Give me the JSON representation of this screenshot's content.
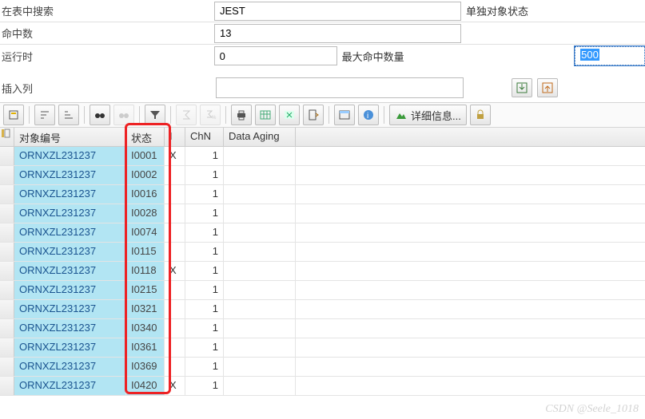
{
  "form": {
    "search_label": "在表中搜索",
    "search_value": "JEST",
    "search_desc": "单独对象状态",
    "hits_label": "命中数",
    "hits_value": "13",
    "runtime_label": "运行时",
    "runtime_value": "0",
    "max_hits_label": "最大命中数量",
    "max_hits_value": "500"
  },
  "insert": {
    "label": "插入列",
    "value": ""
  },
  "detail_label": "详细信息...",
  "columns": {
    "obj": "对象编号",
    "stat": "状态",
    "i": "I",
    "chn": "ChN",
    "da": "Data Aging"
  },
  "rows": [
    {
      "obj": "ORNXZL231237",
      "stat": "I0001",
      "i": "X",
      "chn": "1",
      "da": ""
    },
    {
      "obj": "ORNXZL231237",
      "stat": "I0002",
      "i": "",
      "chn": "1",
      "da": ""
    },
    {
      "obj": "ORNXZL231237",
      "stat": "I0016",
      "i": "",
      "chn": "1",
      "da": ""
    },
    {
      "obj": "ORNXZL231237",
      "stat": "I0028",
      "i": "",
      "chn": "1",
      "da": ""
    },
    {
      "obj": "ORNXZL231237",
      "stat": "I0074",
      "i": "",
      "chn": "1",
      "da": ""
    },
    {
      "obj": "ORNXZL231237",
      "stat": "I0115",
      "i": "",
      "chn": "1",
      "da": ""
    },
    {
      "obj": "ORNXZL231237",
      "stat": "I0118",
      "i": "X",
      "chn": "1",
      "da": ""
    },
    {
      "obj": "ORNXZL231237",
      "stat": "I0215",
      "i": "",
      "chn": "1",
      "da": ""
    },
    {
      "obj": "ORNXZL231237",
      "stat": "I0321",
      "i": "",
      "chn": "1",
      "da": ""
    },
    {
      "obj": "ORNXZL231237",
      "stat": "I0340",
      "i": "",
      "chn": "1",
      "da": ""
    },
    {
      "obj": "ORNXZL231237",
      "stat": "I0361",
      "i": "",
      "chn": "1",
      "da": ""
    },
    {
      "obj": "ORNXZL231237",
      "stat": "I0369",
      "i": "",
      "chn": "1",
      "da": ""
    },
    {
      "obj": "ORNXZL231237",
      "stat": "I0420",
      "i": "X",
      "chn": "1",
      "da": ""
    }
  ],
  "watermark": "CSDN @Seele_1018"
}
